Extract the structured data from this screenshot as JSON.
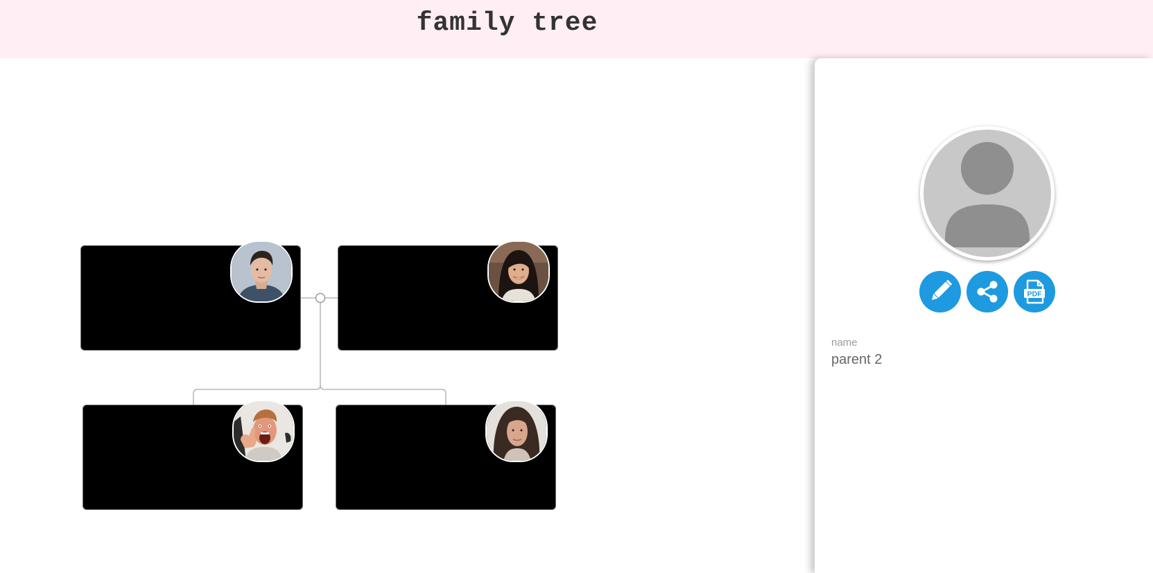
{
  "header": {
    "title": "family tree",
    "background": "#ffeef3"
  },
  "tree": {
    "cards": [
      {
        "id": "parent-1",
        "photo": "man-portrait-photo"
      },
      {
        "id": "parent-2",
        "photo": "woman-smiling-photo"
      },
      {
        "id": "child-1",
        "photo": "man-excited-photo"
      },
      {
        "id": "child-2",
        "photo": "woman-portrait-photo"
      }
    ],
    "card_color": "#000000",
    "link_color": "#b5b5b5"
  },
  "details": {
    "avatar_icon": "person-placeholder-icon",
    "actions": [
      {
        "name": "edit",
        "icon": "pencil-icon"
      },
      {
        "name": "share",
        "icon": "share-icon"
      },
      {
        "name": "pdf",
        "icon": "pdf-icon"
      }
    ],
    "accent_color": "#1e9ae0",
    "fields": [
      {
        "label": "name",
        "value": "parent 2"
      }
    ]
  }
}
